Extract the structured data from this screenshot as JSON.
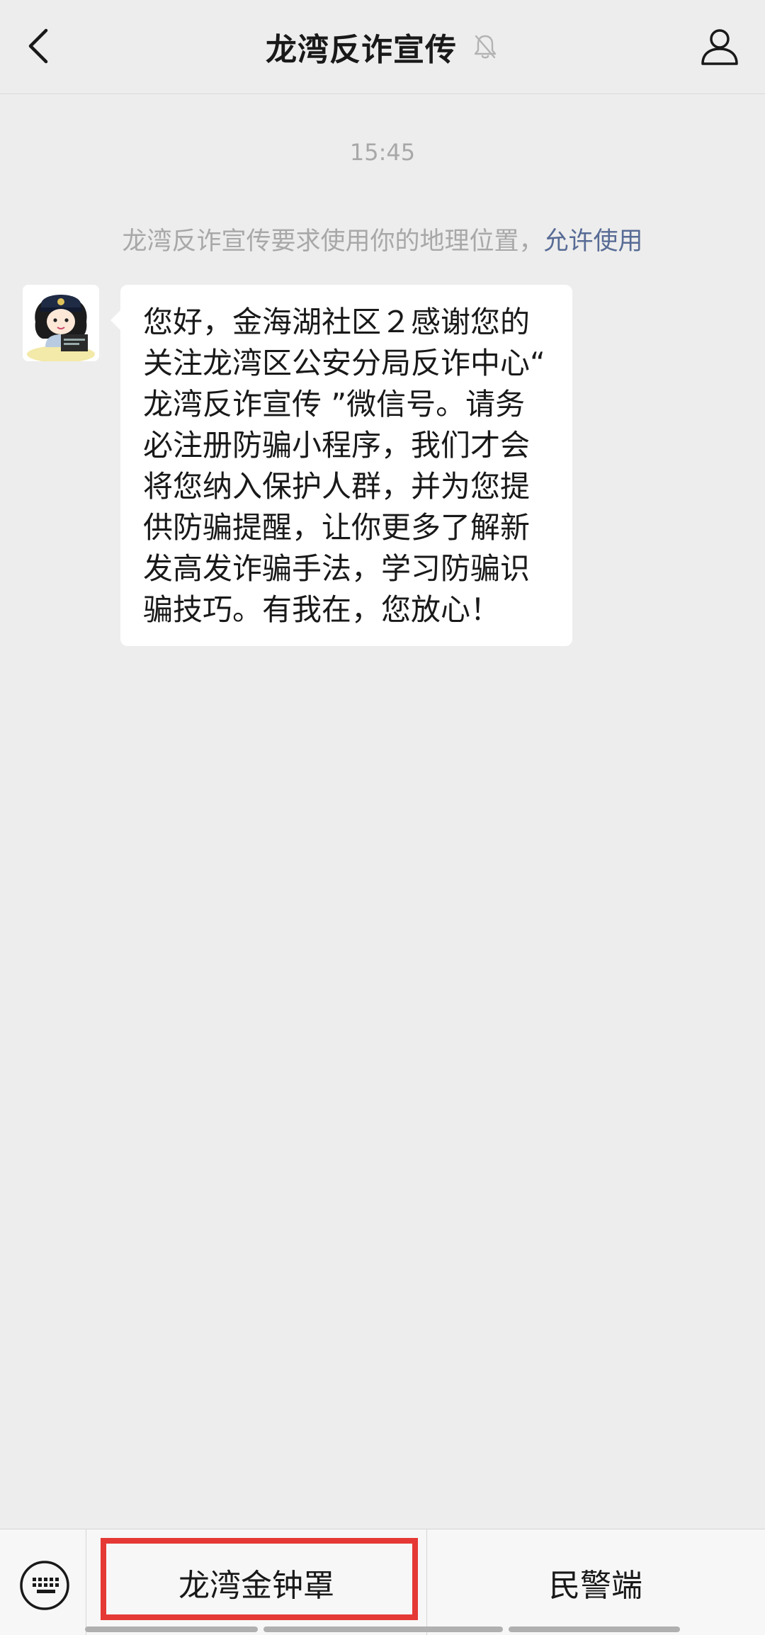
{
  "header": {
    "title": "龙湾反诈宣传",
    "back_icon": "chevron-left-icon",
    "mute_icon": "bell-muted-icon",
    "profile_icon": "person-icon"
  },
  "chat": {
    "timestamp": "15:45",
    "system_notice": {
      "text": "龙湾反诈宣传要求使用你的地理位置，",
      "link": "允许使用"
    },
    "message": {
      "text": "您好，金海湖社区２感谢您的关注龙湾区公安分局反诈中心“ 龙湾反诈宣传 ”微信号。请务必注册防骗小程序，我们才会将您纳入保护人群，并为您提供防骗提醒，让你更多了解新发高发诈骗手法，学习防骗识骗技巧。有我在，您放心！"
    }
  },
  "bottom_menu": {
    "keyboard_icon": "keyboard-icon",
    "item1": "龙湾金钟罩",
    "item2": "民警端"
  },
  "colors": {
    "background": "#ededed",
    "link": "#576b95",
    "highlight": "#e53935",
    "bubble": "#ffffff"
  }
}
